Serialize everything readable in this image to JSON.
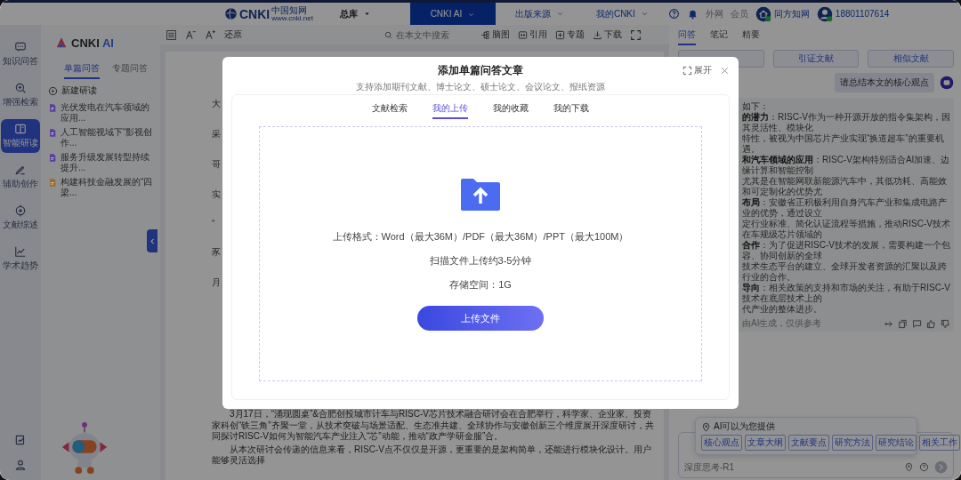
{
  "top_bar": {
    "logo": {
      "mark": "CNKI",
      "name": "中国知网",
      "url": "www.cnki.net"
    },
    "scope": "总库",
    "nav": [
      {
        "label": "CNKI AI",
        "selected": true
      },
      {
        "label": "出版来源",
        "selected": false
      },
      {
        "label": "我的CNKI",
        "selected": false
      }
    ],
    "links": [
      "外网",
      "会员"
    ],
    "accounts": [
      {
        "kind": "org",
        "name": "同方知网"
      },
      {
        "kind": "person",
        "name": "18801107614"
      }
    ]
  },
  "rail": {
    "items": [
      {
        "label": "知识问答",
        "selected": false
      },
      {
        "label": "增强检索",
        "selected": false
      },
      {
        "label": "智能研读",
        "selected": true
      },
      {
        "label": "辅助创作",
        "selected": false
      },
      {
        "label": "文献综述",
        "selected": false
      },
      {
        "label": "学术趋势",
        "selected": false
      }
    ]
  },
  "sidebar": {
    "brand": {
      "mark": "CNKI",
      "accent": "AI"
    },
    "tabs": [
      {
        "label": "单篇问答",
        "selected": true
      },
      {
        "label": "专题问答",
        "selected": false
      }
    ],
    "new_button": "新建研读",
    "documents": [
      {
        "title": "光伏发电在汽车领域的应用...",
        "color": "#5b3d9e"
      },
      {
        "title": "人工智能视域下“影视创作...",
        "color": "#5b3d9e"
      },
      {
        "title": "服务升级发展转型持续提升...",
        "color": "#5b3d9e"
      },
      {
        "title": "构建科技金融发展的“四梁...",
        "color": "#9a6b2e"
      }
    ]
  },
  "reader": {
    "toolbar": {
      "restore": "还原",
      "search_placeholder": "在本文中搜索",
      "actions": [
        {
          "label": "脑图"
        },
        {
          "label": "引用"
        },
        {
          "label": "专题"
        },
        {
          "label": "下载"
        }
      ]
    },
    "line_starts": [
      "大",
      "采",
      "哥",
      "实",
      "“",
      "豕",
      "月"
    ],
    "paragraphs": [
      "3月17日，“涌现圆桌”&合肥创投城市计车与RISC-V芯片技术融合研讨会在合肥举行，科学家、企业家、投资家科创“铁三角”齐聚一堂，从技术突破与场景适配、生态准共建、全球协作与安徽创新三个维度展开深度研讨，共同探讨RISC-V如何为智能汽车产业注入“芯”动能，推动“政产学研金服”合。",
      "从本次研讨会传递的信息来看，RISC-V点不仅仅是开源，更重要的是架构简单，还能进行模块化设计。用户能够灵活选择"
    ]
  },
  "assistant": {
    "tabs": [
      {
        "label": "问答",
        "selected": true
      },
      {
        "label": "笔记",
        "selected": false
      },
      {
        "label": "精要",
        "selected": false
      }
    ],
    "buttons": [
      {
        "label": "引证文献"
      },
      {
        "label": "相似文献"
      }
    ],
    "question": "请总结本文的核心观点",
    "answer": {
      "lines": [
        "如下：",
        "**的潜力**：RISC-V作为一种开源开放的指令集架构，因其灵活性、模块化",
        "特性，被视为中国芯片产业实现“换道超车”的重要机遇。",
        "**和汽车领域的应用**：RISC-V架构特别适合AI加速、边缘计算和智能控制",
        "尤其是在智能网联新能源汽车中，其低功耗、高能效和可定制化的优势尤",
        "**布局**：安徽省正积极利用自身汽车产业和集成电路产业的优势，通过设立",
        "定行业标准、简化认证流程等措施，推动RISC-V技术在车规级芯片领域的",
        "**合作**：为了促进RISC-V技术的发展，需要构建一个包容、协同创新的全球",
        "技术生态平台的建立、全球开发者资源的汇聚以及跨行业的合作。",
        "**导向**：相关政策的支持和市场的关注，有助于RISC-V技术在底层技术上的",
        "代产业的整体进步。"
      ],
      "note": "由AI生成，仅供参考"
    },
    "suggestions": {
      "title": "AI可以为您提供",
      "chips": [
        "核心观点",
        "文章大纲",
        "文献要点",
        "研究方法",
        "研究结论",
        "相关工作"
      ]
    },
    "input": {
      "mode": "深度思考-R1"
    }
  },
  "modal": {
    "title": "添加单篇问答文章",
    "subtitle": "支持添加期刊文献、博士论文、硕士论文、会议论文、报纸资源",
    "expand": "展开",
    "tabs": [
      {
        "label": "文献检索",
        "selected": false
      },
      {
        "label": "我的上传",
        "selected": true
      },
      {
        "label": "我的收藏",
        "selected": false
      },
      {
        "label": "我的下载",
        "selected": false
      }
    ],
    "upload": {
      "formats": "上传格式：Word（最大36M）/PDF（最大36M）/PPT（最大100M）",
      "time": "扫描文件上传约3-5分钟",
      "storage": "存储空间：1G",
      "button": "上传文件"
    }
  }
}
